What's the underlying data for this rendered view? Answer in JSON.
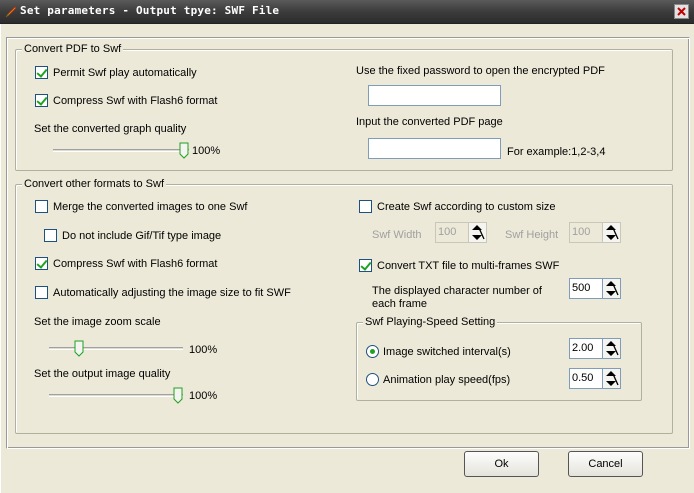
{
  "window": {
    "title": "Set parameters - Output tpye: SWF File"
  },
  "pdf_group": {
    "legend": "Convert PDF to Swf",
    "permit_auto": {
      "label": "Permit Swf play automatically",
      "checked": true
    },
    "compress_flash6": {
      "label": "Compress Swf with Flash6 format",
      "checked": true
    },
    "quality_label": "Set the converted graph quality",
    "quality_value": "100%",
    "quality_level": 1.0,
    "password_label": "Use the fixed password to open the encrypted PDF",
    "password_value": "",
    "page_label": "Input the converted PDF page",
    "page_value": "",
    "page_example": "For example:1,2-3,4"
  },
  "other_group": {
    "legend": "Convert other formats to Swf",
    "merge_images": {
      "label": "Merge the converted images to one Swf",
      "checked": false
    },
    "exclude_gif_tif": {
      "label": "Do not include Gif/Tif type image",
      "checked": false
    },
    "compress_flash6": {
      "label": "Compress Swf with Flash6 format",
      "checked": true
    },
    "auto_adjust": {
      "label": "Automatically adjusting the image size to fit SWF",
      "checked": false
    },
    "zoom_label": "Set the image zoom scale",
    "zoom_value": "100%",
    "zoom_level": 0.2,
    "output_quality_label": "Set the output image quality",
    "output_quality_value": "100%",
    "output_quality_level": 1.0,
    "custom_size": {
      "label": "Create Swf according to custom size",
      "checked": false
    },
    "swf_width_label": "Swf Width",
    "swf_width_value": "100",
    "swf_height_label": "Swf Height",
    "swf_height_value": "100",
    "txt_multiframe": {
      "label": "Convert TXT file to multi-frames SWF",
      "checked": true
    },
    "char_number_label": "The displayed character number of each frame",
    "char_number_value": "500"
  },
  "speed_group": {
    "legend": "Swf Playing-Speed Setting",
    "interval": {
      "label": "Image switched interval(s)",
      "selected": true,
      "value": "2.00"
    },
    "fps": {
      "label": "Animation play speed(fps)",
      "selected": false,
      "value": "0.50"
    }
  },
  "buttons": {
    "ok": "Ok",
    "cancel": "Cancel"
  }
}
